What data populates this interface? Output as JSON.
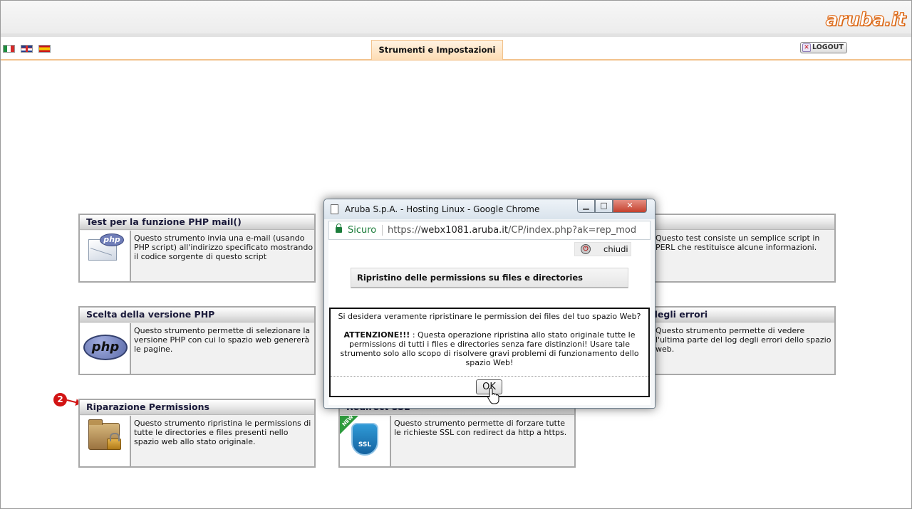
{
  "header": {
    "logo_text": "aruba.it",
    "active_tab": "Strumenti e Impostazioni",
    "logout_label": "LOGOUT",
    "flags": [
      "italian-flag",
      "english-flag",
      "spanish-flag"
    ]
  },
  "tools": [
    {
      "title": "Test per la funzione PHP mail()",
      "description": "Questo strumento invia una e-mail (usando PHP script) all'indirizzo specificato mostrando il codice sorgente di questo script",
      "icon": "php-mail-icon"
    },
    {
      "title": "Scelta della versione PHP",
      "description": "Questo strumento permette di selezionare la versione PHP con cui lo spazio web genererà le pagine.",
      "icon": "php-logo-icon"
    },
    {
      "title": "Riparazione Permissions",
      "description": "Questo strumento ripristina le permissions di tutte le directories e files presenti nello spazio web allo stato originale.",
      "icon": "folder-lock-icon"
    },
    {
      "title": "Redirect SSL",
      "description": "Questo strumento permette di forzare tutte le richieste SSL con redirect da http a https.",
      "icon": "ssl-shield-icon"
    },
    {
      "title": "",
      "description": "Questo test consiste un semplice script in PERL che restituisce alcune informazioni."
    },
    {
      "title": "degli errori",
      "description": "Questo strumento permette di vedere l'ultima parte del log degli errori dello spazio web."
    }
  ],
  "step_badge": "2",
  "popup": {
    "window_title": "Aruba S.p.A. - Hosting Linux - Google Chrome",
    "secure_label": "Sicuro",
    "url_prefix": "https://",
    "url_host": "webx1081.aruba.it",
    "url_path": "/CP/index.php?ak=rep_mod",
    "close_label": "chiudi",
    "heading": "Ripristino delle permissions su files e directories",
    "question": "Si desidera veramente ripristinare le permission dei files del tuo spazio Web?",
    "warning_label": "ATTENZIONE!!!",
    "warning_text": ": Questa operazione ripristina allo stato originale tutte le permissions di tutti i files e directories senza fare distinzioni! Usare tale strumento solo allo scopo di risolvere gravi problemi di funzionamento dello spazio Web!",
    "ok_label": "OK"
  },
  "colors": {
    "accent": "#e06c1a",
    "tab_bg": "#fddcb3",
    "badge": "#d21414",
    "secure": "#1c7d3b"
  }
}
